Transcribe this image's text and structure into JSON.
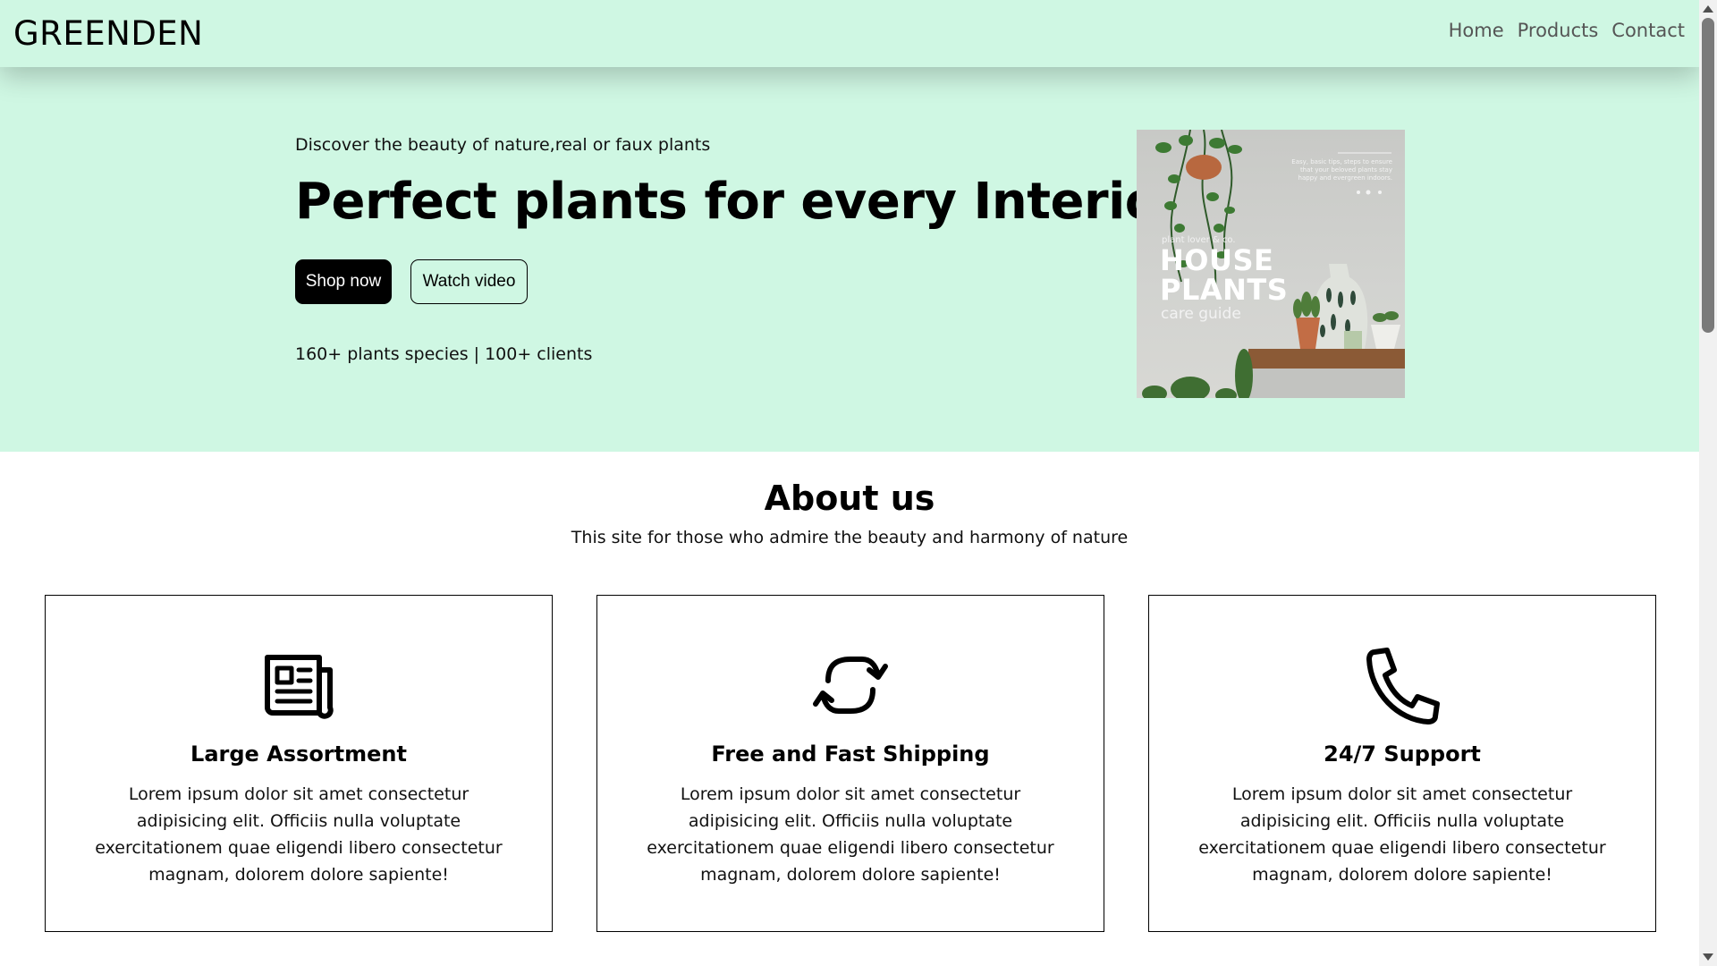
{
  "navbar": {
    "brand": "GREENDEN",
    "links": [
      "Home",
      "Products",
      "Contact"
    ]
  },
  "hero": {
    "tagline": "Discover the beauty of nature,real or faux plants",
    "title": "Perfect plants for every Interior",
    "shop_button": "Shop now",
    "watch_button": "Watch video",
    "stats": "160+ plants species | 100+ clients",
    "image": {
      "small_text": "Easy, basic tips, steps to ensure that your beloved plants stay happy and evergreen indoors.",
      "brand": "plant lover & co.",
      "title_line1": "HOUSE",
      "title_line2": "PLANTS",
      "subtitle": "care guide"
    }
  },
  "about": {
    "title": "About us",
    "subtitle": "This site for those who admire the beauty and harmony of nature"
  },
  "cards": [
    {
      "icon": "newspaper-icon",
      "title": "Large Assortment",
      "text": "Lorem ipsum dolor sit amet consectetur adipisicing elit. Officiis nulla voluptate exercitationem quae eligendi libero consectetur magnam, dolorem dolore sapiente!"
    },
    {
      "icon": "repeat-arrows-icon",
      "title": "Free and Fast Shipping",
      "text": "Lorem ipsum dolor sit amet consectetur adipisicing elit. Officiis nulla voluptate exercitationem quae eligendi libero consectetur magnam, dolorem dolore sapiente!"
    },
    {
      "icon": "phone-icon",
      "title": "24/7 Support",
      "text": "Lorem ipsum dolor sit amet consectetur adipisicing elit. Officiis nulla voluptate exercitationem quae eligendi libero consectetur magnam, dolorem dolore sapiente!"
    }
  ],
  "colors": {
    "mint": "#cff7e3",
    "black": "#000000",
    "nav_link": "#555555"
  }
}
